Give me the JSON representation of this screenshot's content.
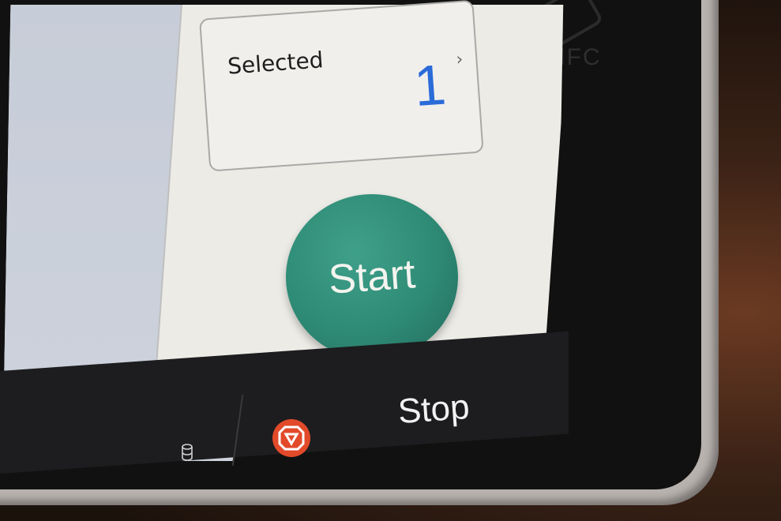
{
  "nfc": {
    "label": "NFC"
  },
  "selected_panel": {
    "label": "Selected",
    "count": "1"
  },
  "start": {
    "label": "Start"
  },
  "stop": {
    "label": "Stop"
  },
  "colors": {
    "start_green": "#2e8a75",
    "stop_red": "#e24a2a",
    "count_blue": "#2a6bd8"
  },
  "icons": {
    "nfc": "nfc-icon",
    "chevron": "chevron-right-icon",
    "storage": "database-icon",
    "stop": "stop-octagon-icon"
  }
}
